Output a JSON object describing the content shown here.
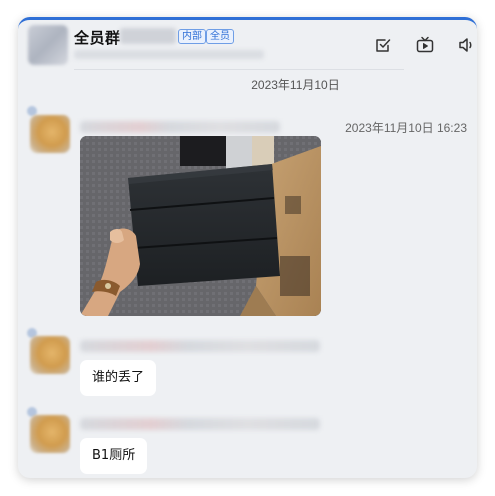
{
  "header": {
    "group_name": "全员群",
    "tags": [
      "内部",
      "全员"
    ]
  },
  "date_separator": "2023年11月10日",
  "messages": [
    {
      "time": "2023年11月10日 16:23",
      "type": "image"
    },
    {
      "type": "text",
      "text": "谁的丢了"
    },
    {
      "type": "text",
      "text": "B1厕所"
    }
  ],
  "colors": {
    "accent": "#2f6fd6",
    "window_bg": "#eef0f3",
    "bubble_bg": "#ffffff"
  },
  "icons": [
    "task-check-icon",
    "tv-play-icon",
    "speaker-icon"
  ]
}
